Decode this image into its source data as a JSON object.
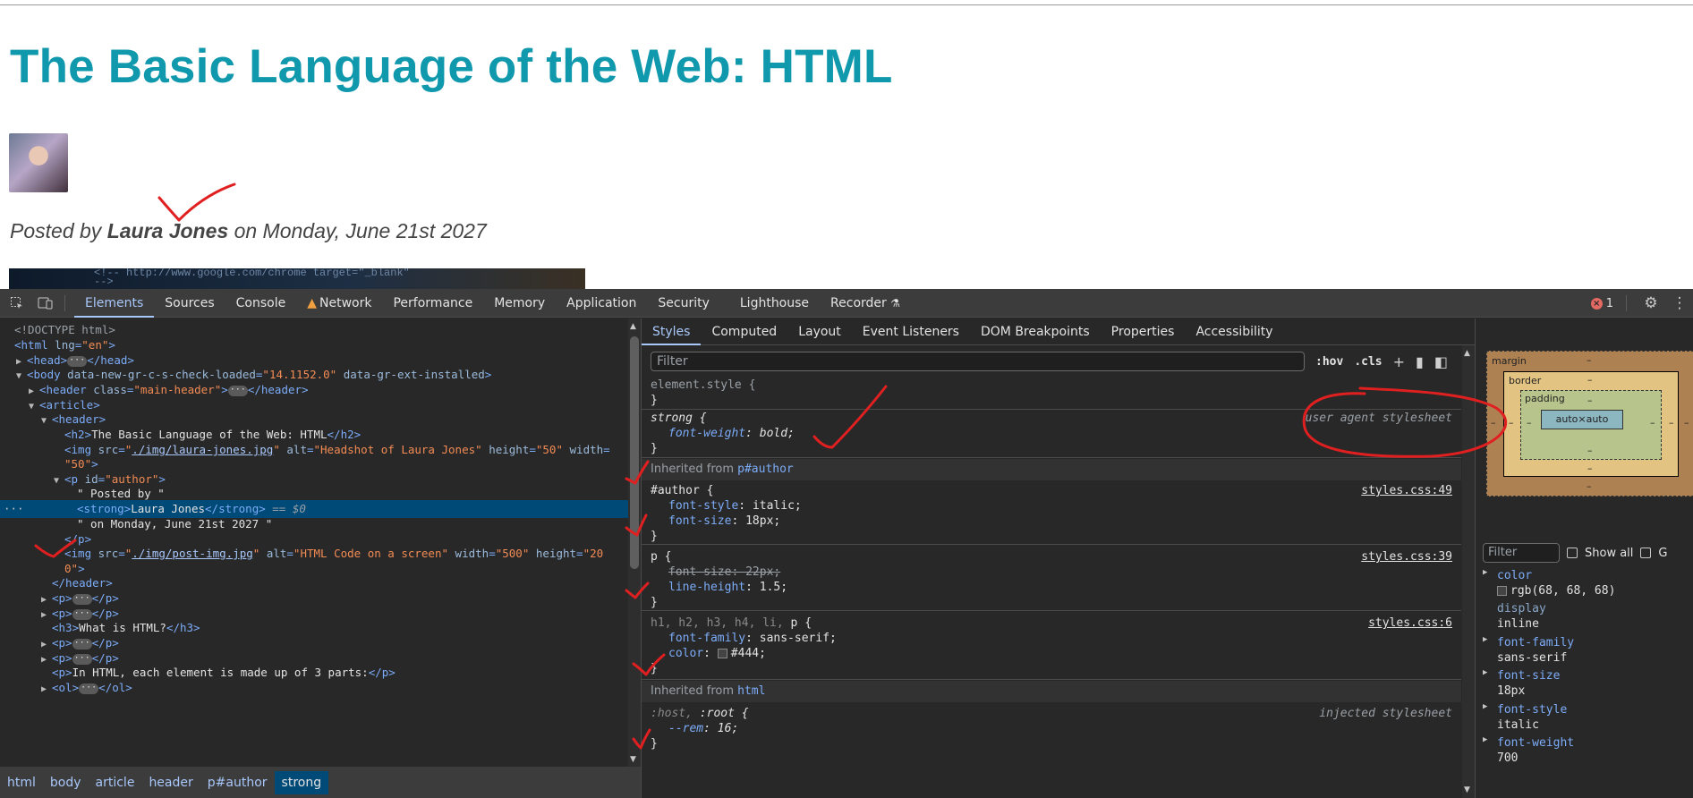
{
  "page": {
    "heading": "The Basic Language of the Web: HTML",
    "author_prefix": "Posted by ",
    "author_name": "Laura Jones",
    "author_suffix": " on Monday, June 21st 2027",
    "post_img_text": "<!-- http://www.google.com/chrome  target=\"_blank\"",
    "post_img_text2": "-->"
  },
  "devtools": {
    "tabs": [
      "Elements",
      "Sources",
      "Console",
      "Network",
      "Performance",
      "Memory",
      "Application",
      "Security",
      "Lighthouse",
      "Recorder"
    ],
    "active_tab": "Elements",
    "error_count": "1",
    "icons": {
      "inspect": "inspect-icon",
      "device": "device-toggle-icon",
      "warning": "warning-icon",
      "recorder": "flask-icon",
      "settings": "gear-icon",
      "menu": "kebab-menu-icon"
    },
    "dom_lines": [
      {
        "html": "<!DOCTYPE html>"
      },
      {
        "html": "<html lng=\"en\">"
      },
      {
        "html": "<head> … </head>"
      },
      {
        "html": "<body data-new-gr-c-s-check-loaded=\"14.1152.0\" data-gr-ext-installed>"
      },
      {
        "html": "<header class=\"main-header\"> … </header>"
      },
      {
        "html": "<article>"
      },
      {
        "html": "<header>"
      },
      {
        "html": "<h2>The Basic Language of the Web: HTML</h2>"
      },
      {
        "html": "<img src=\"./img/laura-jones.jpg\" alt=\"Headshot of Laura Jones\" height=\"50\" width="
      },
      {
        "html": "\"50\">"
      },
      {
        "html": "<p id=\"author\">"
      },
      {
        "html": "\" Posted by \""
      },
      {
        "html": "<strong>Laura Jones</strong> == $0"
      },
      {
        "html": "\" on Monday, June 21st 2027 \""
      },
      {
        "html": "</p>"
      },
      {
        "html": "<img src=\"./img/post-img.jpg\" alt=\"HTML Code on a screen\" width=\"500\" height=\"20"
      },
      {
        "html": "0\">"
      },
      {
        "html": "</header>"
      },
      {
        "html": "<p> … </p>"
      },
      {
        "html": "<p> … </p>"
      },
      {
        "html": "<h3>What is HTML?</h3>"
      },
      {
        "html": "<p> … </p>"
      },
      {
        "html": "<p> … </p>"
      },
      {
        "html": "<p>In HTML, each element is made up of 3 parts:</p>"
      },
      {
        "html": "<ol> … </ol>"
      }
    ],
    "breadcrumbs": [
      "html",
      "body",
      "article",
      "header",
      "p#author",
      "strong"
    ],
    "styles": {
      "subtabs": [
        "Styles",
        "Computed",
        "Layout",
        "Event Listeners",
        "DOM Breakpoints",
        "Properties",
        "Accessibility"
      ],
      "filter_placeholder": "Filter",
      "hov": ":hov",
      "cls": ".cls",
      "rules": [
        {
          "selector": "element.style {",
          "source": "",
          "decls": []
        },
        {
          "selector": "strong {",
          "source": "user agent stylesheet",
          "decls": [
            {
              "p": "font-weight",
              "v": "bold"
            }
          ]
        },
        {
          "inherited": "Inherited from ",
          "from": "p#author"
        },
        {
          "selector": "#author {",
          "source": "styles.css:49",
          "decls": [
            {
              "p": "font-style",
              "v": "italic"
            },
            {
              "p": "font-size",
              "v": "18px"
            }
          ]
        },
        {
          "selector": "p {",
          "source": "styles.css:39",
          "decls": [
            {
              "p": "font-size",
              "v": "22px",
              "struck": true
            },
            {
              "p": "line-height",
              "v": "1.5"
            }
          ]
        },
        {
          "selector": "h1, h2, h3, h4, li, p {",
          "source": "styles.css:6",
          "decls": [
            {
              "p": "font-family",
              "v": "sans-serif"
            },
            {
              "p": "color",
              "v": "#444"
            }
          ]
        },
        {
          "inherited": "Inherited from ",
          "from": "html"
        },
        {
          "selector": ":host, :root {",
          "source": "injected stylesheet",
          "decls": [
            {
              "p": "--rem",
              "v": "16"
            }
          ]
        }
      ]
    },
    "computed": {
      "box": {
        "margin": "margin",
        "border": "border",
        "padding": "padding",
        "content": "auto×auto",
        "dash": "–"
      },
      "filter_placeholder": "Filter",
      "show_all": "Show all",
      "group": "G",
      "props": [
        {
          "name": "color",
          "value": "rgb(68, 68, 68)"
        },
        {
          "name": "display",
          "value": "inline"
        },
        {
          "name": "font-family",
          "value": "sans-serif"
        },
        {
          "name": "font-size",
          "value": "18px"
        },
        {
          "name": "font-style",
          "value": "italic"
        },
        {
          "name": "font-weight",
          "value": "700"
        }
      ]
    }
  },
  "colors": {
    "heading": "#1098ad",
    "text": "#444444",
    "accent": "#a8c7fa",
    "annotation": "#e02020"
  }
}
